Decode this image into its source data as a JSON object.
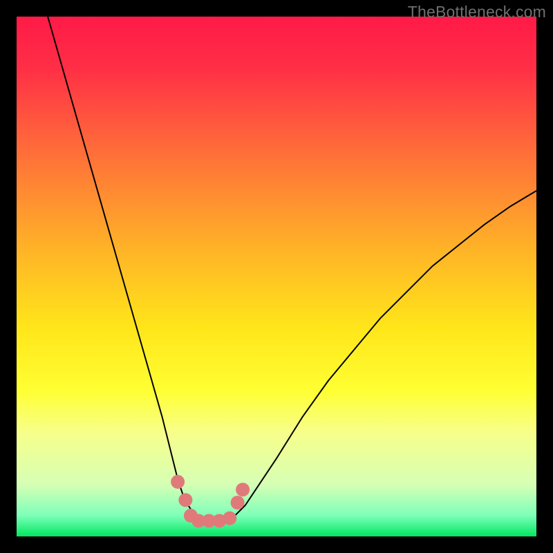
{
  "watermark": "TheBottleneck.com",
  "chart_data": {
    "type": "line",
    "title": "",
    "xlabel": "",
    "ylabel": "",
    "xlim": [
      0,
      100
    ],
    "ylim": [
      0,
      100
    ],
    "grid": false,
    "legend": false,
    "background_gradient": {
      "stops": [
        {
          "offset": 0.0,
          "color": "#ff1a47"
        },
        {
          "offset": 0.1,
          "color": "#ff2f46"
        },
        {
          "offset": 0.25,
          "color": "#ff6a3a"
        },
        {
          "offset": 0.45,
          "color": "#ffb427"
        },
        {
          "offset": 0.6,
          "color": "#ffe61a"
        },
        {
          "offset": 0.72,
          "color": "#ffff33"
        },
        {
          "offset": 0.8,
          "color": "#f7ff8a"
        },
        {
          "offset": 0.9,
          "color": "#d6ffb5"
        },
        {
          "offset": 0.96,
          "color": "#7dffb9"
        },
        {
          "offset": 1.0,
          "color": "#00e860"
        }
      ]
    },
    "series": [
      {
        "name": "bottleneck-curve",
        "color": "#000000",
        "stroke_width": 2,
        "x": [
          6,
          8,
          10,
          12,
          14,
          16,
          18,
          20,
          22,
          24,
          26,
          28,
          30,
          31,
          32,
          33,
          34,
          35,
          36.5,
          38,
          40,
          42,
          44,
          46,
          50,
          55,
          60,
          65,
          70,
          75,
          80,
          85,
          90,
          95,
          100
        ],
        "y": [
          100,
          93,
          86,
          79,
          72,
          65,
          58,
          51,
          44,
          37,
          30,
          23,
          15,
          11,
          8,
          6,
          4.5,
          3.5,
          3,
          3,
          3.2,
          4,
          6,
          9,
          15,
          23,
          30,
          36,
          42,
          47,
          52,
          56,
          60,
          63.5,
          66.5
        ]
      }
    ],
    "markers": {
      "name": "highlight-dots",
      "color": "#e07a7a",
      "radius": 10,
      "points": [
        {
          "x": 31.0,
          "y": 10.5
        },
        {
          "x": 32.5,
          "y": 7.0
        },
        {
          "x": 33.5,
          "y": 4.0
        },
        {
          "x": 35.0,
          "y": 3.0
        },
        {
          "x": 37.0,
          "y": 3.0
        },
        {
          "x": 39.0,
          "y": 3.0
        },
        {
          "x": 41.0,
          "y": 3.5
        },
        {
          "x": 42.5,
          "y": 6.5
        },
        {
          "x": 43.5,
          "y": 9.0
        }
      ]
    }
  }
}
